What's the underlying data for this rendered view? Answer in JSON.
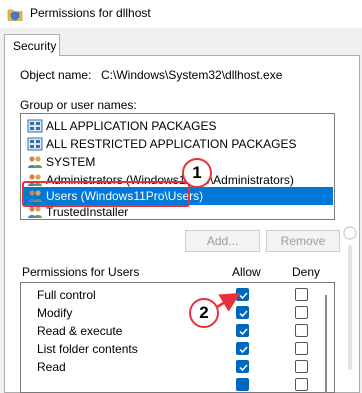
{
  "window": {
    "title": "Permissions for dllhost",
    "icon": "shield-folder-icon"
  },
  "tabs": [
    {
      "label": "Security",
      "active": true
    }
  ],
  "object": {
    "label": "Object name:",
    "value": "C:\\Windows\\System32\\dllhost.exe"
  },
  "group_list": {
    "label": "Group or user names:",
    "items": [
      {
        "label": "ALL APPLICATION PACKAGES",
        "icon": "group-packages-icon",
        "selected": false
      },
      {
        "label": "ALL RESTRICTED APPLICATION PACKAGES",
        "icon": "group-packages-icon",
        "selected": false
      },
      {
        "label": "SYSTEM",
        "icon": "users-icon",
        "selected": false
      },
      {
        "label": "Administrators (Windows11Pro\\Administrators)",
        "icon": "users-icon",
        "selected": false
      },
      {
        "label": "Users (Windows11Pro\\Users)",
        "icon": "users-icon",
        "selected": true
      },
      {
        "label": "TrustedInstaller",
        "icon": "users-icon",
        "selected": false
      }
    ]
  },
  "buttons": {
    "add": "Add...",
    "remove": "Remove"
  },
  "permissions": {
    "header": "Permissions for Users",
    "allow_header": "Allow",
    "deny_header": "Deny",
    "rows": [
      {
        "name": "Full control",
        "allow": true,
        "deny": false
      },
      {
        "name": "Modify",
        "allow": true,
        "deny": false
      },
      {
        "name": "Read & execute",
        "allow": true,
        "deny": false
      },
      {
        "name": "List folder contents",
        "allow": true,
        "deny": false
      },
      {
        "name": "Read",
        "allow": true,
        "deny": false
      }
    ]
  },
  "annotations": {
    "step1": "1",
    "step2": "2",
    "color": "#e8313a"
  },
  "colors": {
    "selection": "#0078d7",
    "checkbox": "#0067c0",
    "annotation": "#e8313a"
  }
}
